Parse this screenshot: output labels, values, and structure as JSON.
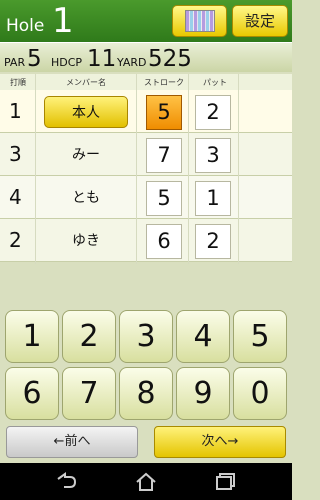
{
  "header": {
    "hole_label": "Hole",
    "hole_number": "1",
    "settings_label": "設定",
    "grid_icon": "scorecard-grid-icon"
  },
  "info": {
    "par_label": "PAR",
    "par_value": "5",
    "hdcp_label": "HDCP",
    "hdcp_value": "11",
    "yard_label": "YARD",
    "yard_value": "525"
  },
  "table": {
    "headers": {
      "order": "打順",
      "member": "メンバー名",
      "stroke": "ストローク",
      "putt": "パット"
    },
    "rows": [
      {
        "order": "1",
        "name": "本人",
        "stroke": "5",
        "putt": "2",
        "selected": true
      },
      {
        "order": "3",
        "name": "みー",
        "stroke": "7",
        "putt": "3",
        "selected": false
      },
      {
        "order": "4",
        "name": "とも",
        "stroke": "5",
        "putt": "1",
        "selected": false
      },
      {
        "order": "2",
        "name": "ゆき",
        "stroke": "6",
        "putt": "2",
        "selected": false
      }
    ]
  },
  "keypad": {
    "keys": [
      "1",
      "2",
      "3",
      "4",
      "5",
      "6",
      "7",
      "8",
      "9",
      "0"
    ]
  },
  "navigation": {
    "prev_label": "←前へ",
    "next_label": "次へ→"
  },
  "system_bar": {
    "icons": [
      "back-icon",
      "home-icon",
      "recent-apps-icon"
    ]
  },
  "colors": {
    "header_green": "#3d8a24",
    "button_yellow": "#f5dc20",
    "selected_orange": "#f5a020",
    "panel_background": "#d9dfbf"
  }
}
